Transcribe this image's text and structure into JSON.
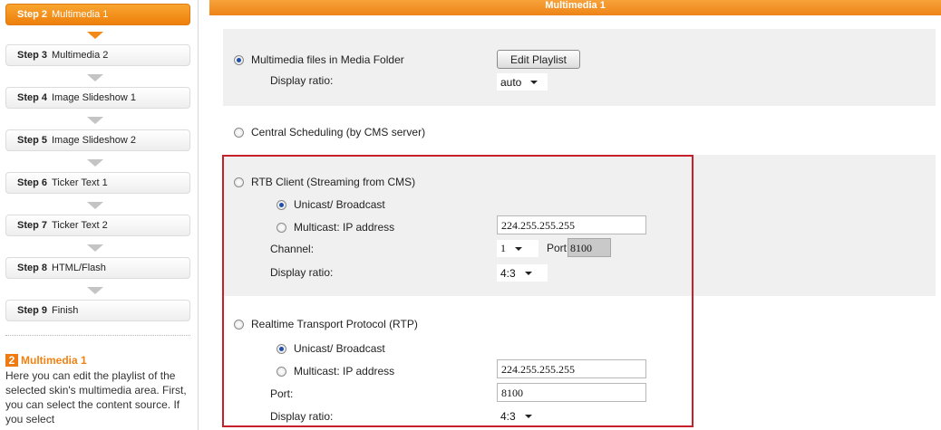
{
  "sidebar": {
    "steps": [
      {
        "num": "Step 2",
        "label": "Multimedia 1"
      },
      {
        "num": "Step 3",
        "label": "Multimedia 2"
      },
      {
        "num": "Step 4",
        "label": "Image Slideshow 1"
      },
      {
        "num": "Step 5",
        "label": "Image Slideshow 2"
      },
      {
        "num": "Step 6",
        "label": "Ticker Text 1"
      },
      {
        "num": "Step 7",
        "label": "Ticker Text 2"
      },
      {
        "num": "Step 8",
        "label": "HTML/Flash"
      },
      {
        "num": "Step 9",
        "label": "Finish"
      }
    ],
    "active_index": 0,
    "info": {
      "badge": "2",
      "title": "Multimedia 1",
      "description": "Here you can edit the playlist of the selected skin's multimedia area. First, you can select the content source. If you select"
    }
  },
  "header": {
    "title": "Multimedia 1"
  },
  "sections": {
    "media_folder": {
      "label": "Multimedia files in Media Folder",
      "selected": true,
      "edit_button": "Edit Playlist",
      "display_ratio_label": "Display ratio:",
      "display_ratio_value": "auto"
    },
    "central_scheduling": {
      "label": "Central Scheduling (by CMS server)",
      "selected": false
    },
    "rtb_client": {
      "label": "RTB Client (Streaming from CMS)",
      "selected": false,
      "unicast_label": "Unicast/ Broadcast",
      "unicast_selected": true,
      "multicast_label": "Multicast: IP address",
      "multicast_selected": false,
      "ip_value": "224.255.255.255",
      "channel_label": "Channel:",
      "channel_value": "1",
      "port_label": "Port:",
      "port_value": "8100",
      "display_ratio_label": "Display ratio:",
      "display_ratio_value": "4:3"
    },
    "rtp": {
      "label": "Realtime Transport Protocol (RTP)",
      "selected": false,
      "unicast_label": "Unicast/ Broadcast",
      "unicast_selected": true,
      "multicast_label": "Multicast: IP address",
      "multicast_selected": false,
      "ip_value": "224.255.255.255",
      "port_label": "Port:",
      "port_value": "8100",
      "display_ratio_label": "Display ratio:",
      "display_ratio_value": "4:3"
    }
  },
  "colors": {
    "accent_orange": "#ee8417",
    "highlight_red": "#c8202b",
    "radio_selected": "#1f4fa8",
    "band_gray": "#f0f0f0"
  }
}
